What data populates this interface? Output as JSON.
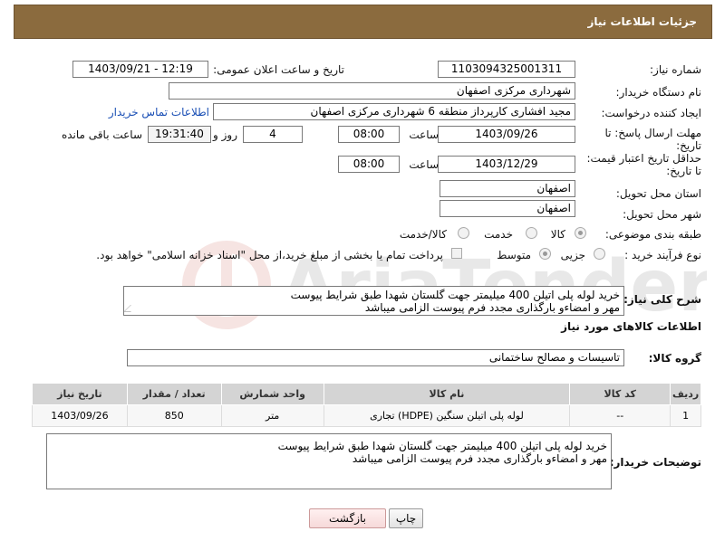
{
  "header": {
    "title": "جزئیات اطلاعات نیاز"
  },
  "form": {
    "need_number": {
      "label": "شماره نیاز:",
      "value": "1103094325001311"
    },
    "announce_datetime": {
      "label": "تاریخ و ساعت اعلان عمومی:",
      "value": "1403/09/21 - 12:19"
    },
    "buyer_org": {
      "label": "نام دستگاه خریدار:",
      "value": "شهرداری مرکزی اصفهان"
    },
    "requester": {
      "label": "ایجاد کننده درخواست:",
      "value": "مجید افشاری کارپرداز منطقه 6 شهرداری مرکزی اصفهان",
      "contact_link": "اطلاعات تماس خریدار"
    },
    "reply_deadline": {
      "label": "مهلت ارسال پاسخ: تا تاریخ:",
      "date": "1403/09/26",
      "time_label": "ساعت",
      "time": "08:00",
      "days": "4",
      "days_label": "روز و",
      "remaining_time": "19:31:40",
      "remaining_label": "ساعت باقی مانده"
    },
    "price_validity": {
      "label": "حداقل تاریخ اعتبار قیمت: تا تاریخ:",
      "date": "1403/12/29",
      "time_label": "ساعت",
      "time": "08:00"
    },
    "delivery_province": {
      "label": "استان محل تحویل:",
      "value": "اصفهان"
    },
    "delivery_city": {
      "label": "شهر محل تحویل:",
      "value": "اصفهان"
    },
    "category": {
      "label": "طبقه بندی موضوعی:",
      "options": [
        "کالا",
        "خدمت",
        "کالا/خدمت"
      ],
      "selected": "کالا"
    },
    "purchase_process": {
      "label": "نوع فرآیند خرید :",
      "options": [
        "جزیی",
        "متوسط"
      ],
      "selected": "متوسط",
      "payment_note": "پرداخت تمام یا بخشی از مبلغ خرید،از محل \"اسناد خزانه اسلامی\" خواهد بود."
    }
  },
  "description": {
    "label": "شرح کلی نیاز:",
    "line1": "خرید لوله پلی اتیلن 400 میلیمتر جهت گلستان شهدا طبق شرایط پیوست",
    "line2": "مهر و امضاءو بارگذاری مجدد فرم پیوست الزامی میباشد"
  },
  "goods_section": {
    "title": "اطلاعات کالاهای مورد نیاز"
  },
  "goods_group": {
    "label": "گروه کالا:",
    "value": "تاسیسات و مصالح ساختمانی"
  },
  "table": {
    "headers": [
      "ردیف",
      "کد کالا",
      "نام کالا",
      "واحد شمارش",
      "تعداد / مقدار",
      "تاریخ نیاز"
    ],
    "rows": [
      [
        "1",
        "--",
        "لوله پلی اتیلن سنگین (HDPE) تجاری",
        "متر",
        "850",
        "1403/09/26"
      ]
    ]
  },
  "buyer_notes": {
    "label": "توضیحات خریدار:",
    "line1": "خرید لوله پلی اتیلن 400 میلیمتر جهت گلستان شهدا طبق شرایط پیوست",
    "line2": "مهر و امضاءو بارگذاری مجدد فرم پیوست الزامی میباشد"
  },
  "buttons": {
    "print": "چاپ",
    "back": "بازگشت"
  },
  "watermark": {
    "text": "AriaTender.neT"
  },
  "colors": {
    "header_bg": "#8b6b3e",
    "link": "#1a4fb5",
    "table_header": "#d4d4d4"
  }
}
